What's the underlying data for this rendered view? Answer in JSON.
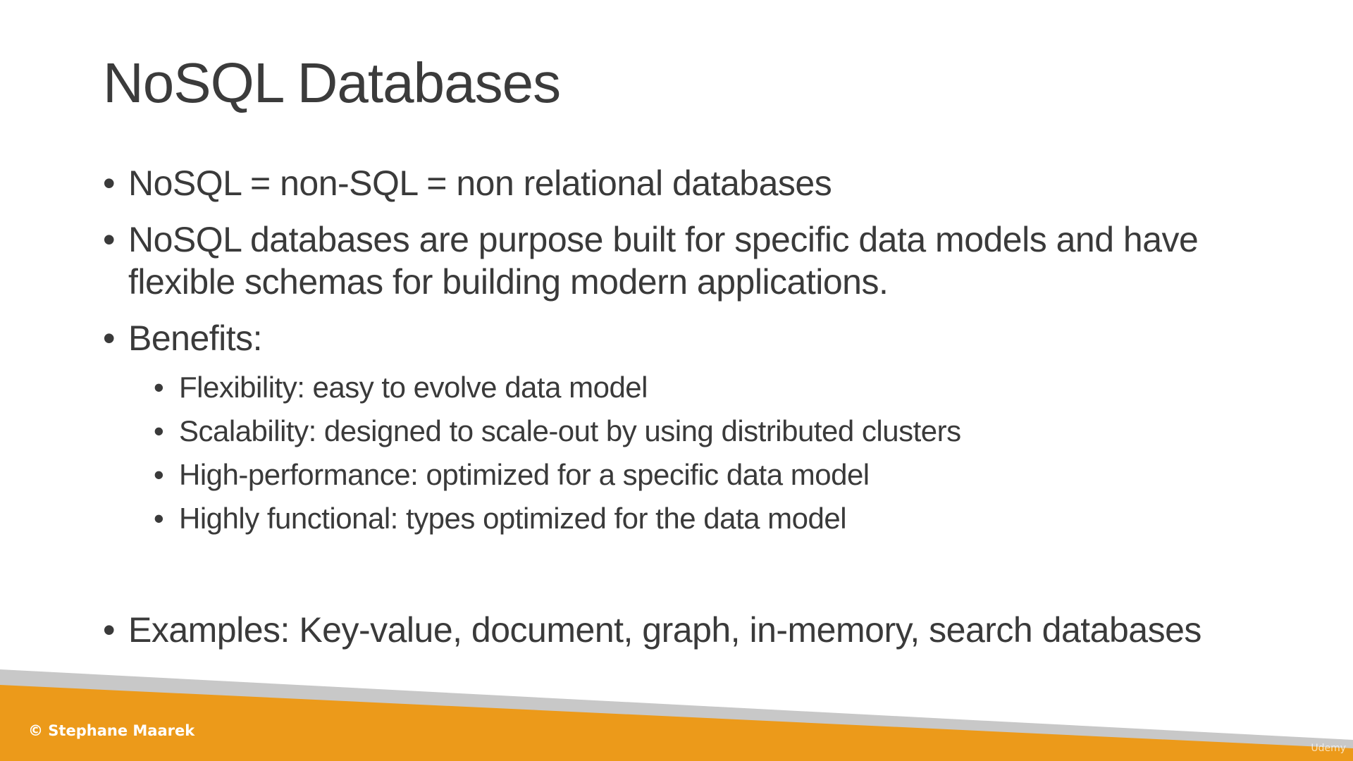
{
  "slide": {
    "title": "NoSQL Databases",
    "bullets": [
      "NoSQL = non-SQL = non relational databases",
      "NoSQL databases are purpose built for specific data models and have flexible schemas for building modern applications.",
      "Benefits:"
    ],
    "benefits": [
      "Flexibility: easy to evolve data model",
      "Scalability: designed to scale-out by using distributed clusters",
      "High-performance: optimized for a specific data model",
      "Highly functional: types optimized for the data model"
    ],
    "examples": "Examples: Key-value, document, graph, in-memory, search databases"
  },
  "footer": {
    "copyright": "© Stephane Maarek",
    "watermark": "Udemy"
  },
  "colors": {
    "accent_orange": "#EC9A1A",
    "accent_grey": "#C8C8C8",
    "text": "#3A3A3A"
  }
}
